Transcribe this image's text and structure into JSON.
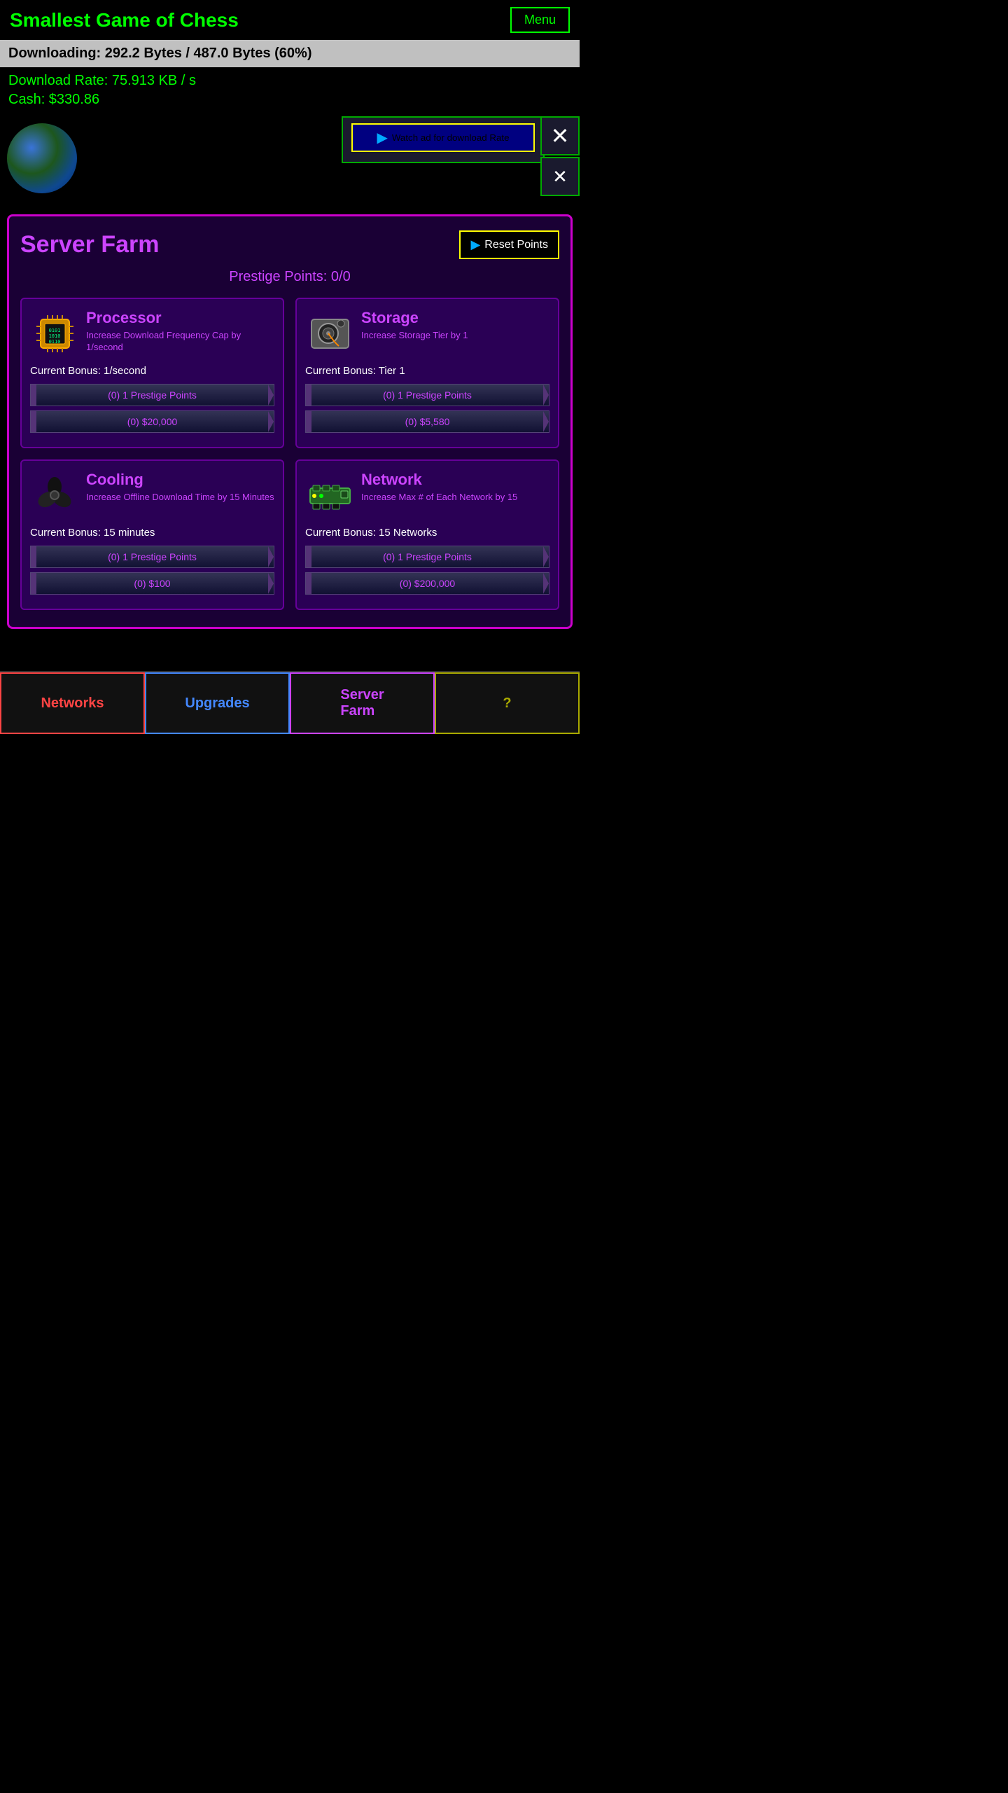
{
  "header": {
    "title": "Smallest Game of Chess",
    "menu_label": "Menu"
  },
  "download": {
    "text": "Downloading: 292.2 Bytes / 487.0 Bytes (60%)",
    "progress_percent": 60
  },
  "stats": {
    "download_rate": "Download Rate: 75.913 KB / s",
    "cash": "Cash: $330.86"
  },
  "ad": {
    "button_label": "Watch ad for download Rate",
    "video_icon": "▶"
  },
  "modal": {
    "title": "Server Farm",
    "reset_label": "Reset Points",
    "prestige": "Prestige Points: 0/0",
    "upgrades": [
      {
        "id": "processor",
        "name": "Processor",
        "desc": "Increase Download Frequency Cap by 1/second",
        "current_bonus": "Current Bonus: 1/second",
        "btn_prestige": "(0) 1 Prestige Points",
        "btn_cash": "(0) $20,000"
      },
      {
        "id": "storage",
        "name": "Storage",
        "desc": "Increase Storage Tier by 1",
        "current_bonus": "Current Bonus: Tier 1",
        "btn_prestige": "(0) 1 Prestige Points",
        "btn_cash": "(0) $5,580"
      },
      {
        "id": "cooling",
        "name": "Cooling",
        "desc": "Increase Offline Download Time by 15 Minutes",
        "current_bonus": "Current Bonus: 15 minutes",
        "btn_prestige": "(0) 1 Prestige Points",
        "btn_cash": "(0) $100"
      },
      {
        "id": "network",
        "name": "Network",
        "desc": "Increase Max # of Each Network by 15",
        "current_bonus": "Current Bonus: 15 Networks",
        "btn_prestige": "(0) 1 Prestige Points",
        "btn_cash": "(0) $200,000"
      }
    ]
  },
  "bottom_nav": [
    {
      "id": "networks",
      "label": "Networks",
      "color": "nav-networks"
    },
    {
      "id": "upgrades",
      "label": "Upgrades",
      "color": "nav-upgrades"
    },
    {
      "id": "server-farm",
      "label": "Server\nFarm",
      "color": "nav-server"
    },
    {
      "id": "question",
      "label": "?",
      "color": "nav-question"
    }
  ]
}
